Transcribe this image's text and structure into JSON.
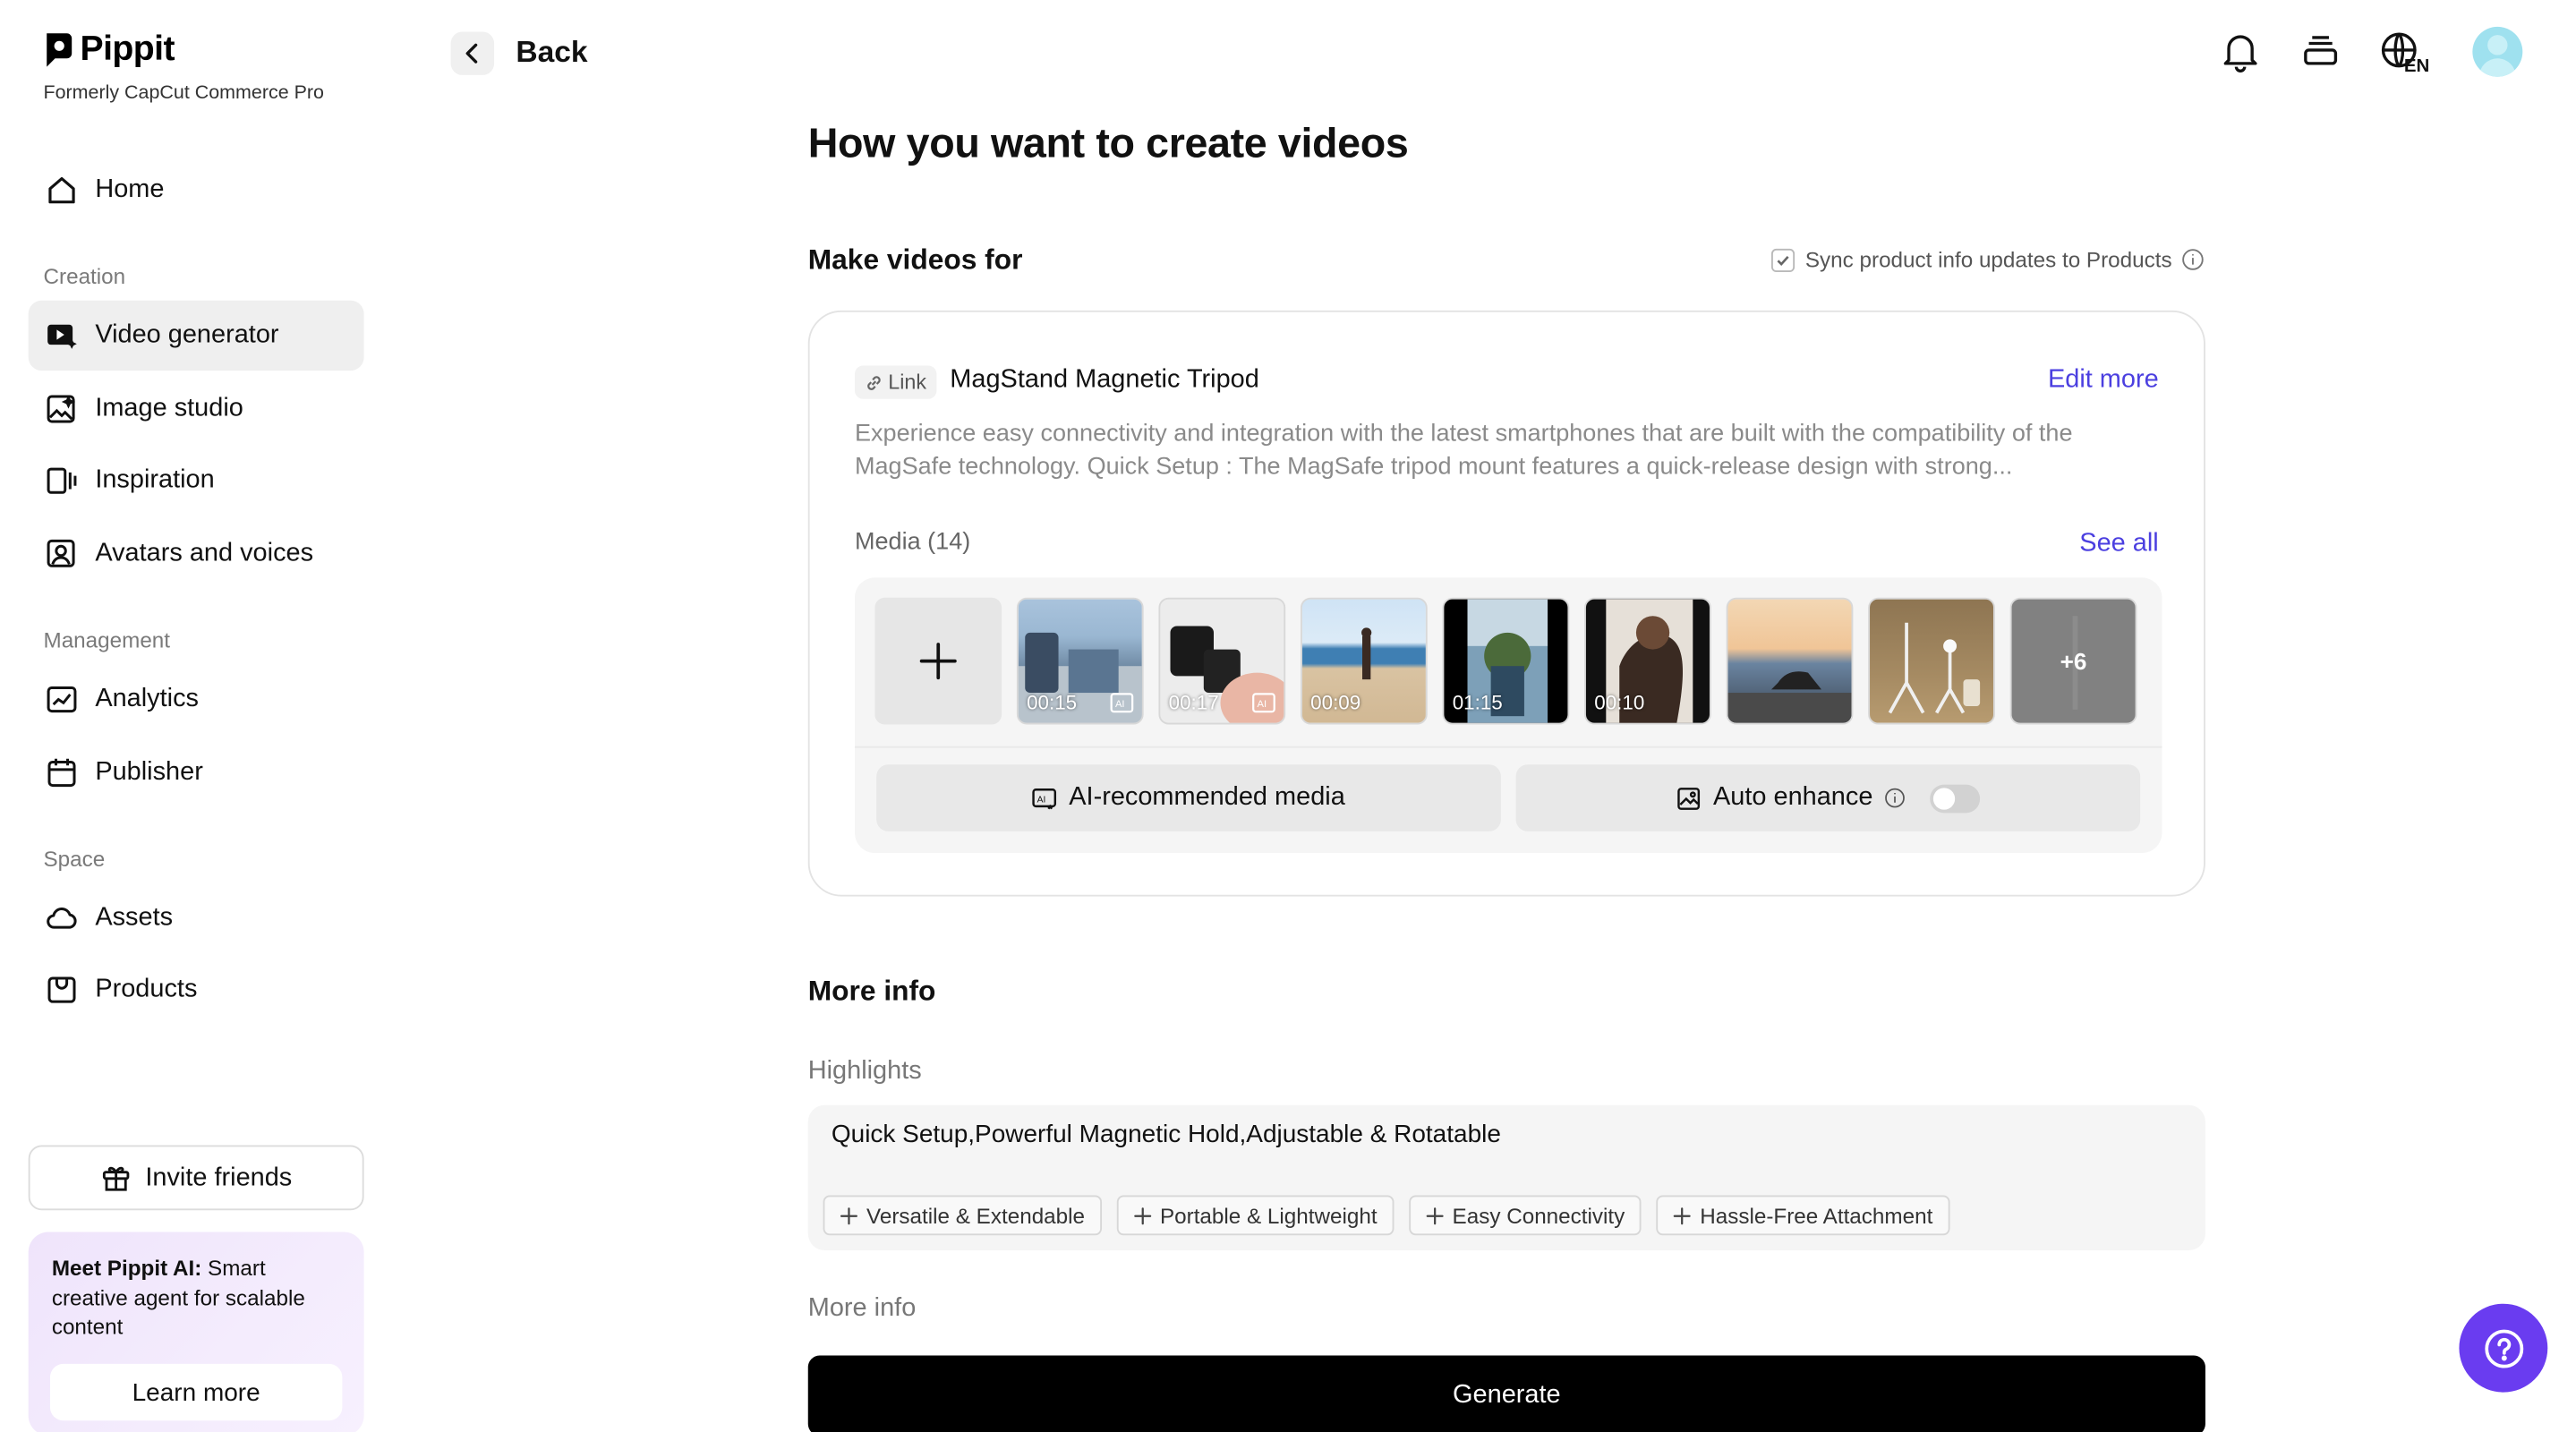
{
  "brand": {
    "name": "Pippit",
    "subtitle": "Formerly CapCut Commerce Pro"
  },
  "sidebar": {
    "home": "Home",
    "sections": {
      "creation": "Creation",
      "management": "Management",
      "space": "Space"
    },
    "items": {
      "video_generator": "Video generator",
      "image_studio": "Image studio",
      "inspiration": "Inspiration",
      "avatars_voices": "Avatars and voices",
      "analytics": "Analytics",
      "publisher": "Publisher",
      "assets": "Assets",
      "products": "Products"
    },
    "active": "video_generator",
    "invite": "Invite friends",
    "promo": {
      "bold": "Meet Pippit AI:",
      "text": " Smart creative agent for scalable content",
      "button": "Learn more"
    }
  },
  "header": {
    "back": "Back",
    "language": "EN"
  },
  "main": {
    "title": "How you want to create videos",
    "make_videos_for": "Make videos for",
    "sync_label": "Sync product info updates to Products",
    "sync_checked": true,
    "product": {
      "source_tag": "Link",
      "name": "MagStand Magnetic Tripod",
      "edit_more": "Edit more",
      "description": "Experience easy connectivity and integration with the latest smartphones that are built with the compatibility of the MagSafe technology. Quick Setup : The MagSafe tripod mount features a quick-release design with strong...",
      "media_label": "Media (14)",
      "see_all": "See all",
      "media": [
        {
          "duration": "00:15",
          "ai": true
        },
        {
          "duration": "00:17",
          "ai": true
        },
        {
          "duration": "00:09",
          "ai": false
        },
        {
          "duration": "01:15",
          "ai": false
        },
        {
          "duration": "00:10",
          "ai": false
        },
        {
          "duration": "",
          "ai": false
        },
        {
          "duration": "",
          "ai": false
        },
        {
          "duration": "",
          "ai": false,
          "more": "+6"
        }
      ],
      "ai_recommended": "AI-recommended media",
      "auto_enhance": "Auto enhance",
      "auto_enhance_on": false
    },
    "more_info_heading": "More info",
    "highlights_label": "Highlights",
    "highlights_value": "Quick Setup,Powerful Magnetic Hold,Adjustable & Rotatable",
    "suggestions": [
      "Versatile & Extendable",
      "Portable & Lightweight",
      "Easy Connectivity",
      "Hassle-Free Attachment"
    ],
    "more_info_label": "More info",
    "generate": "Generate"
  },
  "colors": {
    "accent_link": "#4b3fe0",
    "help_fab": "#6a3cf0",
    "primary_button": "#000000"
  }
}
